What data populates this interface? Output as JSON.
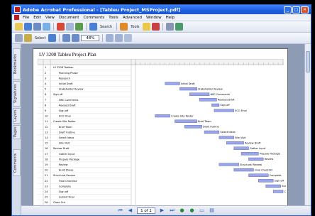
{
  "window": {
    "title": "Adobe Acrobat Professional - [Tableu Project_MSProject.pdf]",
    "minimize": "_",
    "maximize": "□",
    "close": "✕"
  },
  "menu": [
    "File",
    "Edit",
    "View",
    "Document",
    "Comments",
    "Tools",
    "Advanced",
    "Window",
    "Help"
  ],
  "toolbar": {
    "search_label": "Search",
    "select_label": "Select",
    "zoom_value": "48%",
    "tools_label": "Tools"
  },
  "navpane": {
    "tabs": [
      "Bookmarks",
      "Signatures",
      "Layers",
      "Pages",
      "Comments"
    ]
  },
  "document": {
    "title": "LV 3208 Tableu Project Plan"
  },
  "status": {
    "page_value": "1 of 1"
  },
  "gantt_rows": [
    "LV 3208 Tableau",
    "Planning Phase",
    "Research",
    "Initial Draft",
    "Stakeholder Review",
    "Sign off",
    "NRC Comments",
    "Revised Draft",
    "Sign off",
    "ECO Final",
    "Create Site Roster",
    "Brief Team",
    "Draft Outline",
    "Select Ideas",
    "Site Visit",
    "Review Draft",
    "Gather Input",
    "Prepare Package",
    "Review",
    "Build Phase",
    "Structural Review",
    "Final Checklist",
    "Complete",
    "Sign off",
    "Submit Final",
    "Close Out"
  ],
  "chart_data": {
    "type": "gantt",
    "title": "LV 3208 Tableu Project Plan",
    "tasks": [
      {
        "label": "Initial Draft",
        "start": 12,
        "end": 18,
        "summary": false
      },
      {
        "label": "Stakeholder Review",
        "start": 18,
        "end": 25,
        "summary": false
      },
      {
        "label": "NRC Comments",
        "start": 22,
        "end": 30,
        "summary": false
      },
      {
        "label": "Revised Draft",
        "start": 26,
        "end": 33,
        "summary": false
      },
      {
        "label": "Sign off",
        "start": 31,
        "end": 34,
        "summary": false
      },
      {
        "label": "ECO Final",
        "start": 32,
        "end": 40,
        "summary": false
      },
      {
        "label": "Create Site Roster",
        "start": 8,
        "end": 14,
        "summary": false
      },
      {
        "label": "Brief Team",
        "start": 16,
        "end": 25,
        "summary": false
      },
      {
        "label": "Draft Outline",
        "start": 20,
        "end": 27,
        "summary": false
      },
      {
        "label": "Select Ideas",
        "start": 28,
        "end": 34,
        "summary": false
      },
      {
        "label": "Site Visit",
        "start": 34,
        "end": 40,
        "summary": false
      },
      {
        "label": "Review Draft",
        "start": 37,
        "end": 44,
        "summary": false
      },
      {
        "label": "Gather Input",
        "start": 40,
        "end": 46,
        "summary": false
      },
      {
        "label": "Prepare Package",
        "start": 43,
        "end": 50,
        "summary": false
      },
      {
        "label": "Review",
        "start": 46,
        "end": 52,
        "summary": false
      },
      {
        "label": "Structural Review",
        "start": 34,
        "end": 42,
        "summary": false
      },
      {
        "label": "Final Checklist",
        "start": 40,
        "end": 48,
        "summary": false
      },
      {
        "label": "Complete",
        "start": 46,
        "end": 54,
        "summary": false
      },
      {
        "label": "Sign off",
        "start": 50,
        "end": 56,
        "summary": false
      },
      {
        "label": "Submit Final",
        "start": 53,
        "end": 59,
        "summary": false
      },
      {
        "label": "Close Out",
        "start": 56,
        "end": 60,
        "summary": false
      }
    ]
  },
  "colors": {
    "bar": "#9aa6e8",
    "bar_border": "#3b4fb0",
    "titlebar": "#1d5ee0"
  }
}
